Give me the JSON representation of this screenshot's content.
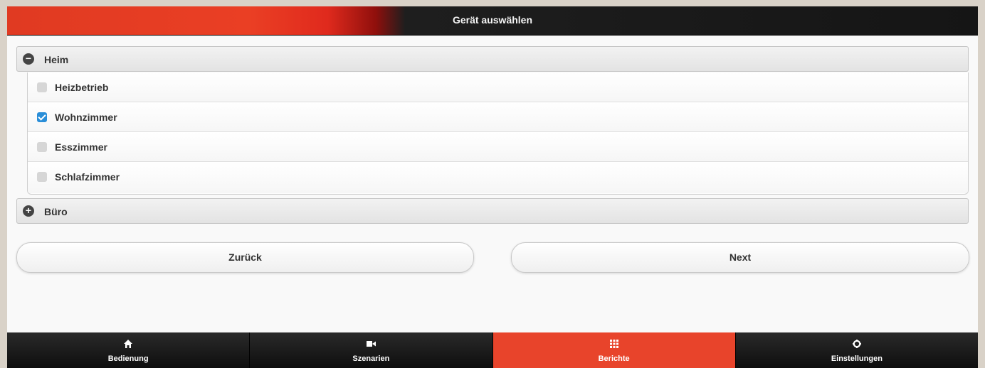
{
  "header": {
    "title": "Gerät auswählen"
  },
  "groups": [
    {
      "label": "Heim",
      "expanded": true,
      "icon": "minus-circle-icon",
      "items": [
        {
          "label": "Heizbetrieb",
          "checked": false
        },
        {
          "label": "Wohnzimmer",
          "checked": true
        },
        {
          "label": "Esszimmer",
          "checked": false
        },
        {
          "label": "Schlafzimmer",
          "checked": false
        }
      ]
    },
    {
      "label": "Büro",
      "expanded": false,
      "icon": "plus-circle-icon"
    }
  ],
  "buttons": {
    "back": "Zurück",
    "next": "Next"
  },
  "nav": [
    {
      "label": "Bedienung",
      "icon": "home-icon",
      "active": false
    },
    {
      "label": "Szenarien",
      "icon": "video-camera-icon",
      "active": false
    },
    {
      "label": "Berichte",
      "icon": "grid-icon",
      "active": true
    },
    {
      "label": "Einstellungen",
      "icon": "gear-icon",
      "active": false
    }
  ],
  "colors": {
    "accent": "#e8442b",
    "checkbox_checked": "#2a8ed8",
    "navbar": "#1a1a1a"
  }
}
